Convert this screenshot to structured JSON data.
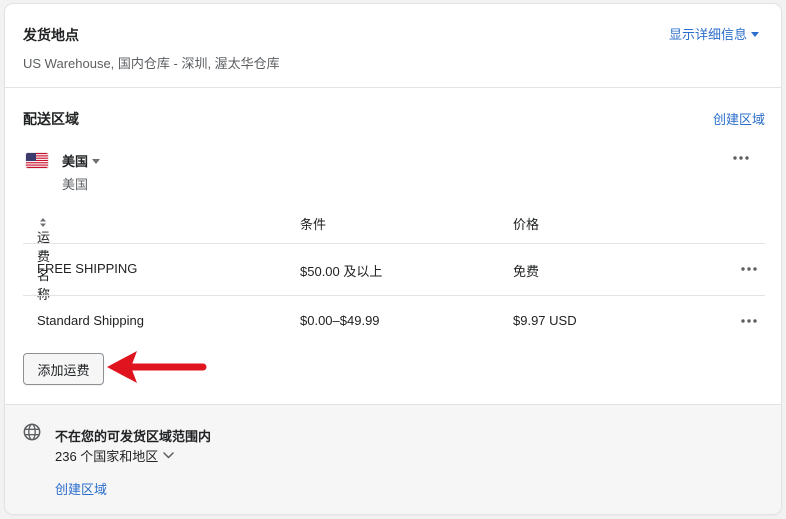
{
  "origin": {
    "title": "发货地点",
    "locations": "US Warehouse, 国内仓库 - 深圳, 渥太华仓库",
    "details_link": "显示详细信息"
  },
  "zones": {
    "title": "配送区域",
    "create_link": "创建区域",
    "zone": {
      "name": "美国",
      "countries": "美国",
      "flag_icon": "us-flag-icon"
    },
    "table": {
      "headers": [
        "运费名称",
        "条件",
        "价格"
      ],
      "rows": [
        {
          "name": "FREE SHIPPING",
          "condition": "$50.00 及以上",
          "price": "免费"
        },
        {
          "name": "Standard Shipping",
          "condition": "$0.00–$49.99",
          "price": "$9.97 USD"
        }
      ]
    },
    "add_rate_button": "添加运费"
  },
  "outside": {
    "title": "不在您的可发货区域范围内",
    "count": "236 个国家和地区",
    "create_link": "创建区域",
    "icon": "globe-icon"
  },
  "colors": {
    "link": "#2c6ecb",
    "annotation_arrow": "#e0141e"
  }
}
